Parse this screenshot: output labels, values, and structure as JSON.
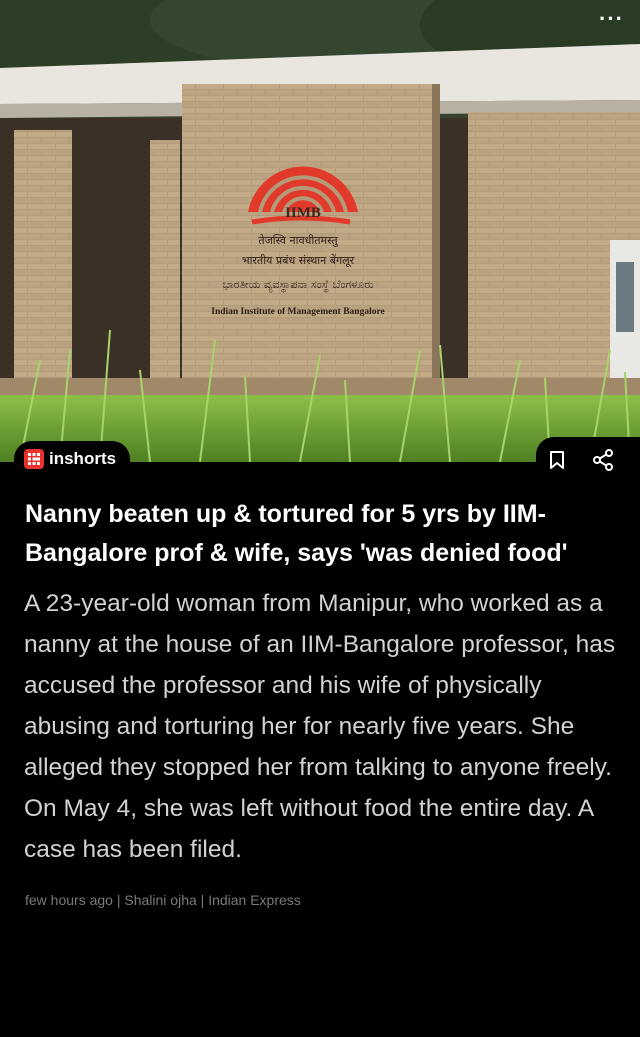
{
  "hero": {
    "image_description_icon": "iimb-building-photo",
    "sign": {
      "logo_text": "IIMB",
      "line1": "तेजस्वि नावधीतमस्तु",
      "line2": "भारतीय प्रबंध संस्थान बेंगलूर",
      "line3": "ಭಾರತೀಯ ವ್ಯವಸ್ಥಾಪನಾ ಸಂಸ್ಥೆ ಬೆಂಗಳೂರು",
      "line4": "Indian Institute of Management Bangalore"
    },
    "more_icon": "more-options-icon"
  },
  "brand": {
    "name": "inshorts",
    "logo_icon": "inshorts-logo-icon"
  },
  "actions": {
    "bookmark_icon": "bookmark-icon",
    "share_icon": "share-icon"
  },
  "article": {
    "headline": "Nanny beaten up & tortured for 5 yrs by IIM-Bangalore prof & wife, says 'was denied food'",
    "body": "A 23-year-old woman from Manipur, who worked as a nanny at the house of an IIM-Bangalore professor, has accused the professor and his wife of physically abusing and torturing her for nearly five years. She alleged they stopped her from talking to anyone freely. On May 4, she was left without food the entire day. A case has been filed.",
    "time": "few hours ago",
    "author": "Shalini ojha",
    "source": "Indian Express",
    "separator": " | "
  },
  "colors": {
    "background": "#000000",
    "brand_red": "#e8322f",
    "headline": "#ffffff",
    "body": "#d2d2d2",
    "meta": "#7a7a7a"
  }
}
